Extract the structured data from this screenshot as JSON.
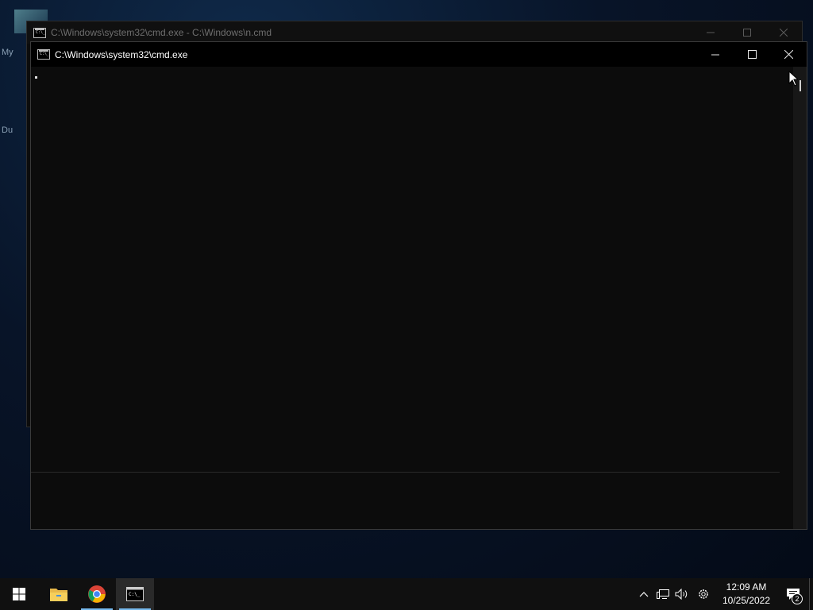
{
  "desktop": {
    "label_1": "My",
    "label_2": "Du"
  },
  "back_window": {
    "title": "C:\\Windows\\system32\\cmd.exe - C:\\Windows\\n.cmd"
  },
  "front_window": {
    "title": "C:\\Windows\\system32\\cmd.exe"
  },
  "taskbar": {
    "clock_time": "12:09 AM",
    "clock_date": "10/25/2022",
    "notification_count": "2",
    "accent_color": "#76b9ed"
  },
  "icons": [
    "start-icon",
    "file-explorer-icon",
    "chrome-icon",
    "cmd-icon",
    "chevron-up-icon",
    "network-icon",
    "volume-icon",
    "settings-icon",
    "action-center-icon"
  ]
}
